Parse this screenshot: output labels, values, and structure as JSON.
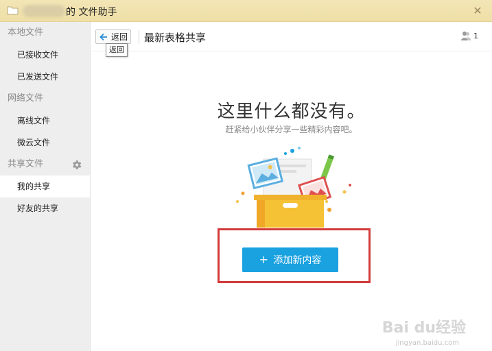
{
  "window": {
    "title": "的 文件助手",
    "close_icon": "close-icon"
  },
  "sidebar": {
    "sections": [
      {
        "label": "本地文件",
        "items": [
          {
            "label": "已接收文件"
          },
          {
            "label": "已发送文件"
          }
        ]
      },
      {
        "label": "网络文件",
        "items": [
          {
            "label": "离线文件"
          },
          {
            "label": "微云文件"
          }
        ]
      },
      {
        "label": "共享文件",
        "items": [
          {
            "label": "我的共享",
            "active": true
          },
          {
            "label": "好友的共享"
          }
        ]
      }
    ]
  },
  "toolbar": {
    "back_label": "返回",
    "back_tooltip": "返回",
    "page_title": "最新表格共享",
    "member_count": "1"
  },
  "empty_state": {
    "title": "这里什么都没有。",
    "subtitle": "赶紧给小伙伴分享一些精彩内容吧。",
    "add_label": "添加新内容",
    "add_symbol": "+"
  },
  "watermark": {
    "text": "Bai du经验",
    "url": "jingyan.baidu.com"
  },
  "colors": {
    "titlebar": "#f0e2ad",
    "accent": "#1aa1e0",
    "highlight": "#d23b3b",
    "sidebar": "#eeeeee"
  }
}
